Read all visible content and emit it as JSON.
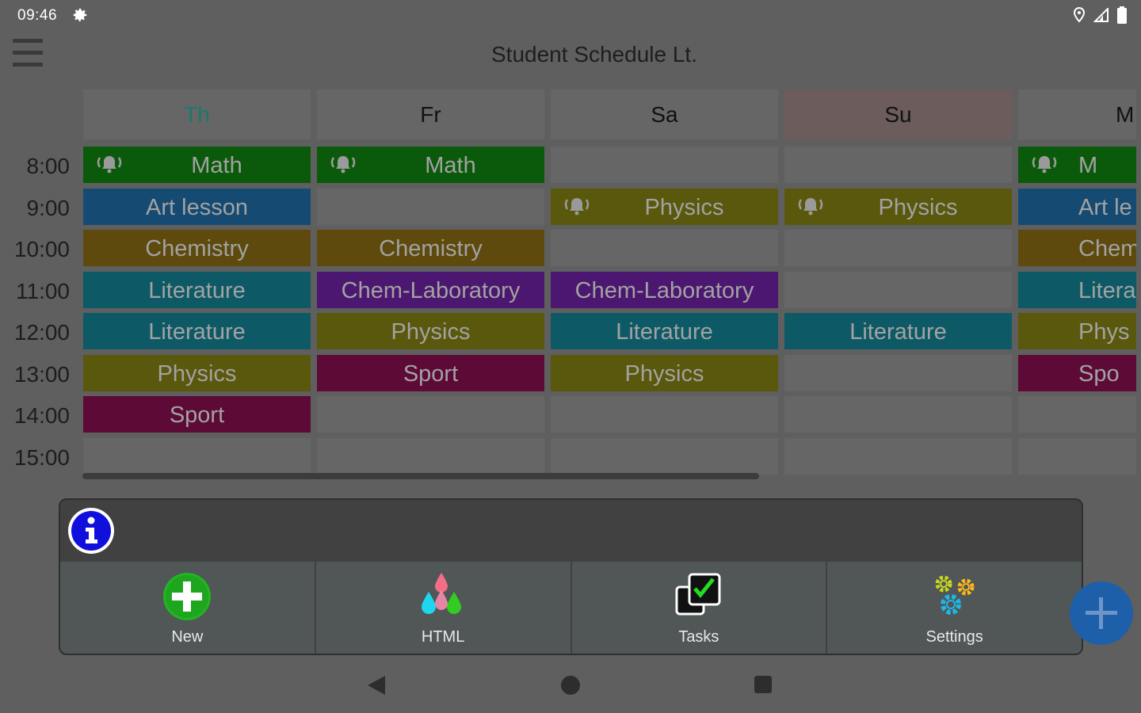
{
  "status": {
    "time": "09:46"
  },
  "app": {
    "title": "Student Schedule Lt."
  },
  "days": [
    {
      "label": "Th",
      "color": "#1a7a6a",
      "bg": "#666666"
    },
    {
      "label": "Fr",
      "color": "#111111",
      "bg": "#666666"
    },
    {
      "label": "Sa",
      "color": "#111111",
      "bg": "#666666"
    },
    {
      "label": "Su",
      "color": "#111111",
      "bg": "#6d5c5c"
    },
    {
      "label": "M",
      "color": "#111111",
      "bg": "#666666"
    }
  ],
  "times": [
    "8:00",
    "9:00",
    "10:00",
    "11:00",
    "12:00",
    "13:00",
    "14:00",
    "15:00"
  ],
  "subject_colors": {
    "Math": "#0b5a0b",
    "Art lesson": "#154b72",
    "Chemistry": "#5d4a0c",
    "Literature": "#0d5a66",
    "Chem-Laboratory": "#4c1770",
    "Physics": "#5a580c",
    "Sport": "#5d0a36"
  },
  "schedule": [
    [
      {
        "subject": "Math",
        "alarm": true
      },
      {
        "subject": "Art lesson"
      },
      {
        "subject": "Chemistry"
      },
      {
        "subject": "Literature"
      },
      {
        "subject": "Literature"
      },
      {
        "subject": "Physics"
      },
      {
        "subject": "Sport"
      },
      null
    ],
    [
      {
        "subject": "Math",
        "alarm": true
      },
      null,
      {
        "subject": "Chemistry"
      },
      {
        "subject": "Chem-Laboratory"
      },
      {
        "subject": "Physics"
      },
      {
        "subject": "Sport"
      },
      null,
      null
    ],
    [
      null,
      {
        "subject": "Physics",
        "alarm": true
      },
      null,
      {
        "subject": "Chem-Laboratory"
      },
      {
        "subject": "Literature"
      },
      {
        "subject": "Physics"
      },
      null,
      null
    ],
    [
      null,
      {
        "subject": "Physics",
        "alarm": true
      },
      null,
      null,
      {
        "subject": "Literature"
      },
      null,
      null,
      null
    ],
    [
      {
        "subject": "Math",
        "text": "M",
        "alarm": true
      },
      {
        "subject": "Art lesson",
        "text": "Art le"
      },
      {
        "subject": "Chemistry",
        "text": "Chem"
      },
      {
        "subject": "Literature",
        "text": "Litera"
      },
      {
        "subject": "Physics",
        "text": "Phys"
      },
      {
        "subject": "Sport",
        "text": "Spo"
      },
      null,
      null
    ]
  ],
  "actions": [
    {
      "label": "New",
      "icon": "plus-circle-icon"
    },
    {
      "label": "HTML",
      "icon": "color-drops-icon"
    },
    {
      "label": "Tasks",
      "icon": "tasks-checkbox-icon"
    },
    {
      "label": "Settings",
      "icon": "gears-icon"
    }
  ],
  "info_icon": "info-icon",
  "fab_icon": "plus-icon"
}
